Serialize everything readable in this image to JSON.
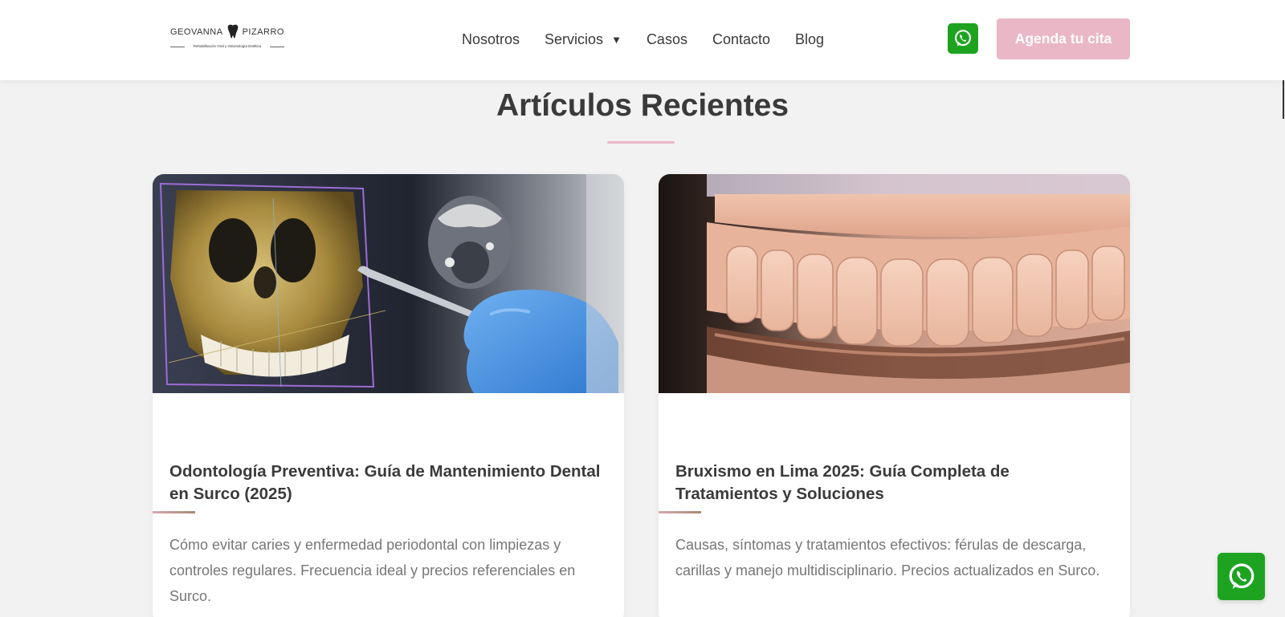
{
  "header": {
    "logo": {
      "name_left": "GEOVANNA",
      "name_right": "PIZARRO",
      "tagline": "Rehabilitación Oral y Odontología Estética"
    },
    "nav": [
      {
        "label": "Nosotros"
      },
      {
        "label": "Servicios",
        "caret": "▼"
      },
      {
        "label": "Casos"
      },
      {
        "label": "Contacto"
      },
      {
        "label": "Blog"
      }
    ],
    "whatsapp_icon": "whatsapp-icon",
    "cta_label": "Agenda tu cita"
  },
  "section": {
    "title": "Artículos Recientes"
  },
  "articles": [
    {
      "image": "dental-3d-scan-image",
      "title": "Odontología Preventiva: Guía de Mantenimiento Dental en Surco (2025)",
      "excerpt": "Cómo evitar caries y enfermedad periodontal con limpiezas y controles regulares. Frecuencia ideal y precios referenciales en Surco."
    },
    {
      "image": "occlusal-splint-image",
      "title": "Bruxismo en Lima 2025: Guía Completa de Tratamientos y Soluciones",
      "excerpt": "Causas, síntomas y tratamientos efectivos: férulas de descarga, carillas y manejo multidisciplinario. Precios actualizados en Surco."
    }
  ],
  "colors": {
    "accent_pink": "#eab7c6",
    "whatsapp_green": "#1ea321",
    "background": "#f2f2f2"
  }
}
